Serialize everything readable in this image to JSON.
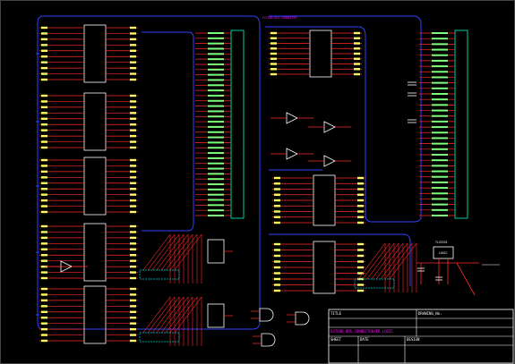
{
  "schematic": {
    "bus_label": "EXTEND BUS CONNECTOR",
    "colors": {
      "background": "#000000",
      "wire": "#ff2a2a",
      "bus": "#3040ff",
      "chip": "#ffffff",
      "net_label": "#ffff66",
      "connector": "#00ffcc",
      "ic_outline": "#00c8c8",
      "title_text": "#ff00ff"
    },
    "title_block": {
      "title_label": "TITLE",
      "drawing_label": "DRAWING_No.",
      "drawing_name": "EXTEND_BUS_CONNECTOR/ER_LOGIC",
      "sheet_label": "SHEET",
      "date_label": "DATE",
      "design_label": "DESIGN"
    },
    "regulator_label": "TLV2333",
    "regulator_sub": "LOGIC"
  }
}
